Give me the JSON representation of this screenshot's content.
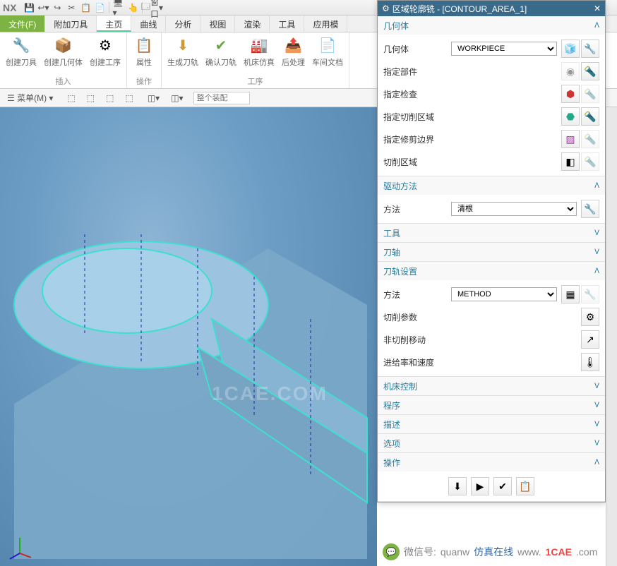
{
  "app": {
    "name": "NX",
    "window_menu": "窗口"
  },
  "tabs": {
    "file": "文件(F)",
    "addon": "附加刀具",
    "home": "主页",
    "curve": "曲线",
    "analyze": "分析",
    "view": "视图",
    "render": "渲染",
    "tool": "工具",
    "app": "应用模"
  },
  "ribbon": {
    "group1": {
      "label": "插入",
      "btns": [
        "创建刀具",
        "创建几何体",
        "创建工序"
      ]
    },
    "group2": {
      "label": "操作",
      "btns": [
        "属性"
      ]
    },
    "group3": {
      "label": "工序",
      "btns": [
        "生成刀轨",
        "确认刀轨",
        "机床仿真",
        "后处理",
        "车间文档"
      ]
    }
  },
  "toolbar2": {
    "menu": "菜单(M)",
    "search_placeholder": "整个装配"
  },
  "panel": {
    "title": "区域轮廓铣 - [CONTOUR_AREA_1]",
    "sections": {
      "geometry": {
        "title": "几何体",
        "geom_label": "几何体",
        "geom_value": "WORKPIECE",
        "part": "指定部件",
        "check": "指定检查",
        "cut_area": "指定切削区域",
        "trim_bound": "指定修剪边界",
        "cut_region": "切削区域"
      },
      "drive": {
        "title": "驱动方法",
        "method_label": "方法",
        "method_value": "清根"
      },
      "tool": {
        "title": "工具"
      },
      "axis": {
        "title": "刀轴"
      },
      "path": {
        "title": "刀轨设置",
        "method_label": "方法",
        "method_value": "METHOD",
        "cut_params": "切削参数",
        "noncut": "非切削移动",
        "feed": "进给率和速度"
      },
      "machine": {
        "title": "机床控制"
      },
      "program": {
        "title": "程序"
      },
      "desc": {
        "title": "描述"
      },
      "options": {
        "title": "选项"
      },
      "ops": {
        "title": "操作"
      }
    }
  },
  "watermark": "1CAE.COM",
  "footer": {
    "wechat": "微信号:",
    "handle": "quanw",
    "brand1": "仿真在线",
    "brand2": "www.",
    "brand3": "1CAE",
    "brand4": ".com"
  }
}
